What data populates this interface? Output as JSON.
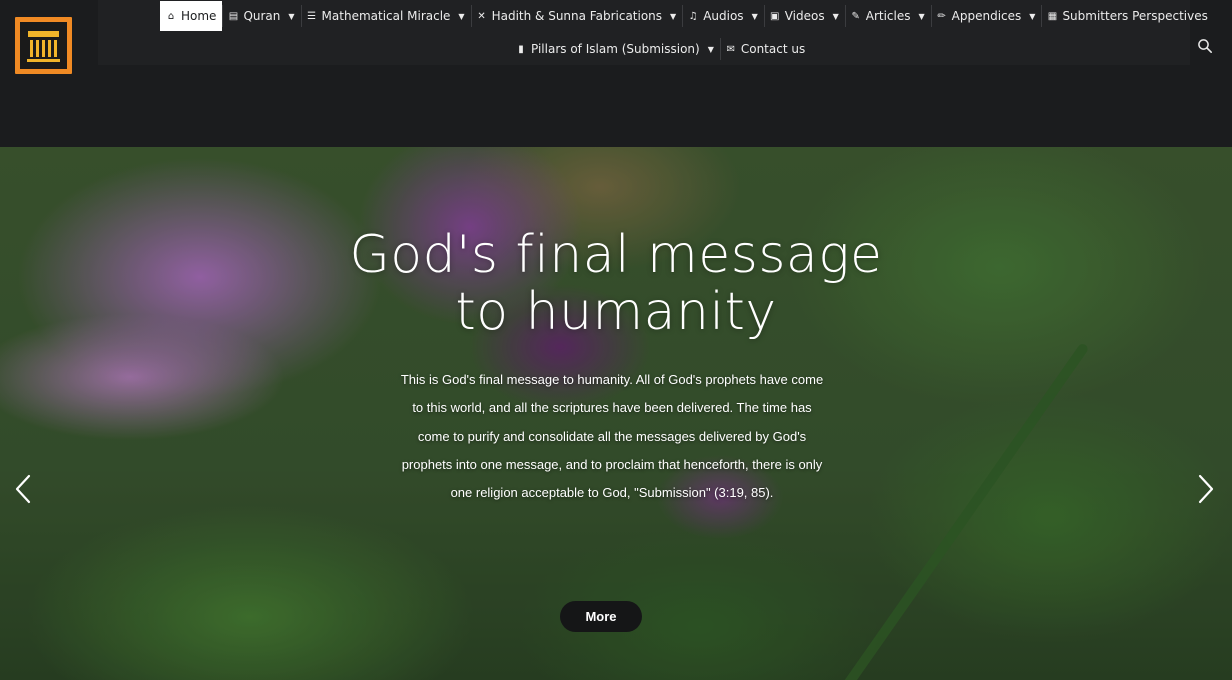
{
  "nav": {
    "row1": [
      {
        "icon": "home-icon",
        "glyph": "⌂",
        "label": "Home",
        "caret": false,
        "active": true
      },
      {
        "icon": "book-icon",
        "glyph": "▤",
        "label": "Quran",
        "caret": true
      },
      {
        "icon": "list-icon",
        "glyph": "☰",
        "label": "Mathematical Miracle",
        "caret": true
      },
      {
        "icon": "x-icon",
        "glyph": "✕",
        "label": "Hadith & Sunna Fabrications",
        "caret": true
      },
      {
        "icon": "music-icon",
        "glyph": "♫",
        "label": "Audios",
        "caret": true
      },
      {
        "icon": "video-icon",
        "glyph": "▣",
        "label": "Videos",
        "caret": true
      },
      {
        "icon": "edit-icon",
        "glyph": "✎",
        "label": "Articles",
        "caret": true
      },
      {
        "icon": "pencil-icon",
        "glyph": "✏",
        "label": "Appendices",
        "caret": true
      },
      {
        "icon": "table-icon",
        "glyph": "▦",
        "label": "Submitters Perspectives",
        "caret": false
      }
    ],
    "row2": [
      {
        "icon": "bar-chart-icon",
        "glyph": "▮",
        "label": "Pillars of Islam (Submission)",
        "caret": true
      },
      {
        "icon": "mail-icon",
        "glyph": "✉",
        "label": "Contact us",
        "caret": false
      }
    ],
    "caret_glyph": "▼"
  },
  "hero": {
    "title_line1": "God's final message",
    "title_line2": "to humanity",
    "text": "This is God's final message to humanity. All of God's prophets have come to this world, and all the scriptures have been delivered. The time has come to purify and consolidate all the messages delivered by God's prophets into one message, and to proclaim that henceforth, there is only one religion acceptable to God, \"Submission\" (3:19, 85).",
    "more_label": "More"
  },
  "colors": {
    "header_bg": "#1b1c1e",
    "active_tab_bg": "#ffffff",
    "logo_orange": "#f08a24",
    "logo_gold": "#f0b42a",
    "button_bg": "#151617"
  }
}
